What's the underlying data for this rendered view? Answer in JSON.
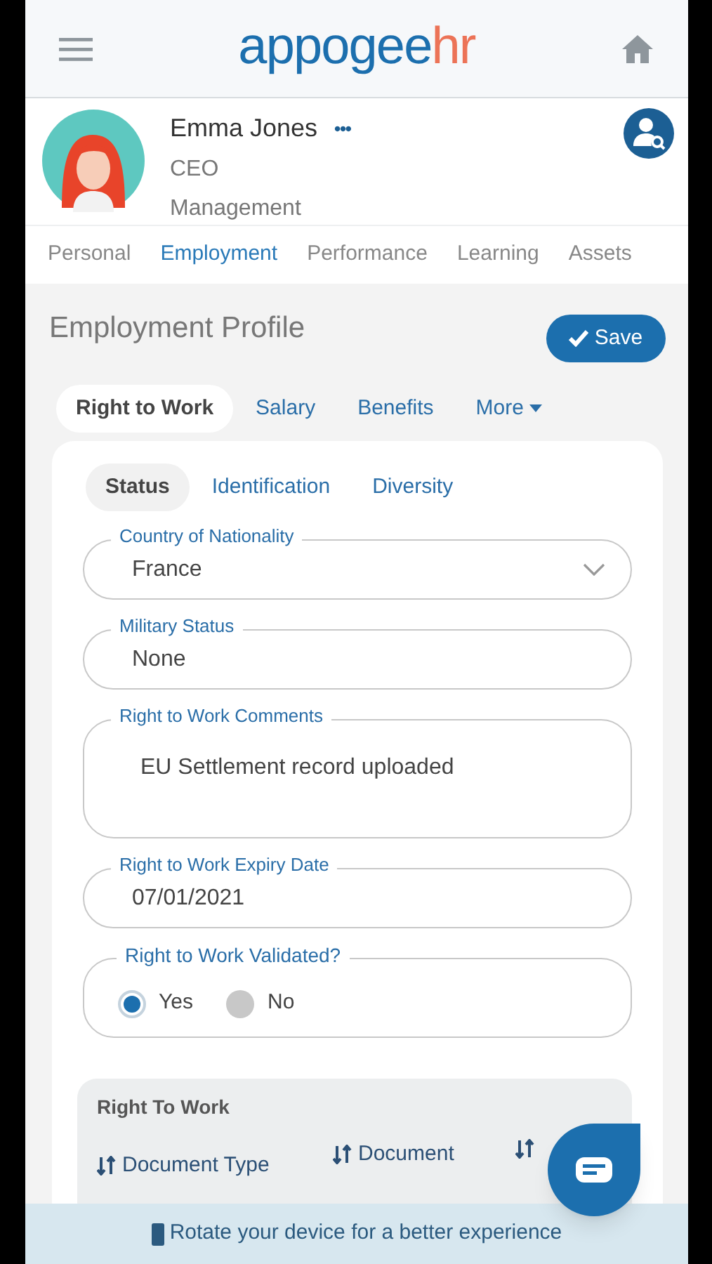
{
  "header": {
    "logo_main": "appogee",
    "logo_accent": "hr"
  },
  "profile": {
    "name": "Emma Jones",
    "more": "•••",
    "title": "CEO",
    "department": "Management"
  },
  "tabs": [
    {
      "label": "Personal",
      "selected": false
    },
    {
      "label": "Employment",
      "selected": true
    },
    {
      "label": "Performance",
      "selected": false
    },
    {
      "label": "Learning",
      "selected": false
    },
    {
      "label": "Assets",
      "selected": false
    }
  ],
  "section": {
    "title": "Employment Profile",
    "save": "Save"
  },
  "subtabs": [
    {
      "label": "Right to Work",
      "selected": true,
      "dropdown": false
    },
    {
      "label": "Salary",
      "selected": false,
      "dropdown": false
    },
    {
      "label": "Benefits",
      "selected": false,
      "dropdown": false
    },
    {
      "label": "More",
      "selected": false,
      "dropdown": true
    }
  ],
  "inner_tabs": [
    {
      "label": "Status",
      "selected": true
    },
    {
      "label": "Identification",
      "selected": false
    },
    {
      "label": "Diversity",
      "selected": false
    }
  ],
  "fields": [
    {
      "kind": "select",
      "label": "Country of Nationality",
      "value": "France"
    },
    {
      "kind": "text",
      "label": "Military Status",
      "value": "None"
    },
    {
      "kind": "textarea",
      "label": "Right to Work Comments",
      "value": "EU Settlement record uploaded"
    },
    {
      "kind": "text",
      "label": "Right to Work Expiry Date",
      "value": "07/01/2021"
    },
    {
      "kind": "radio",
      "label": "Right to Work Validated?",
      "options": [
        {
          "label": "Yes",
          "selected": true
        },
        {
          "label": "No",
          "selected": false
        }
      ]
    }
  ],
  "table": {
    "title": "Right To Work",
    "columns": [
      "Document Type",
      "Document",
      ""
    ]
  },
  "banner": "Rotate your device for a better experience"
}
